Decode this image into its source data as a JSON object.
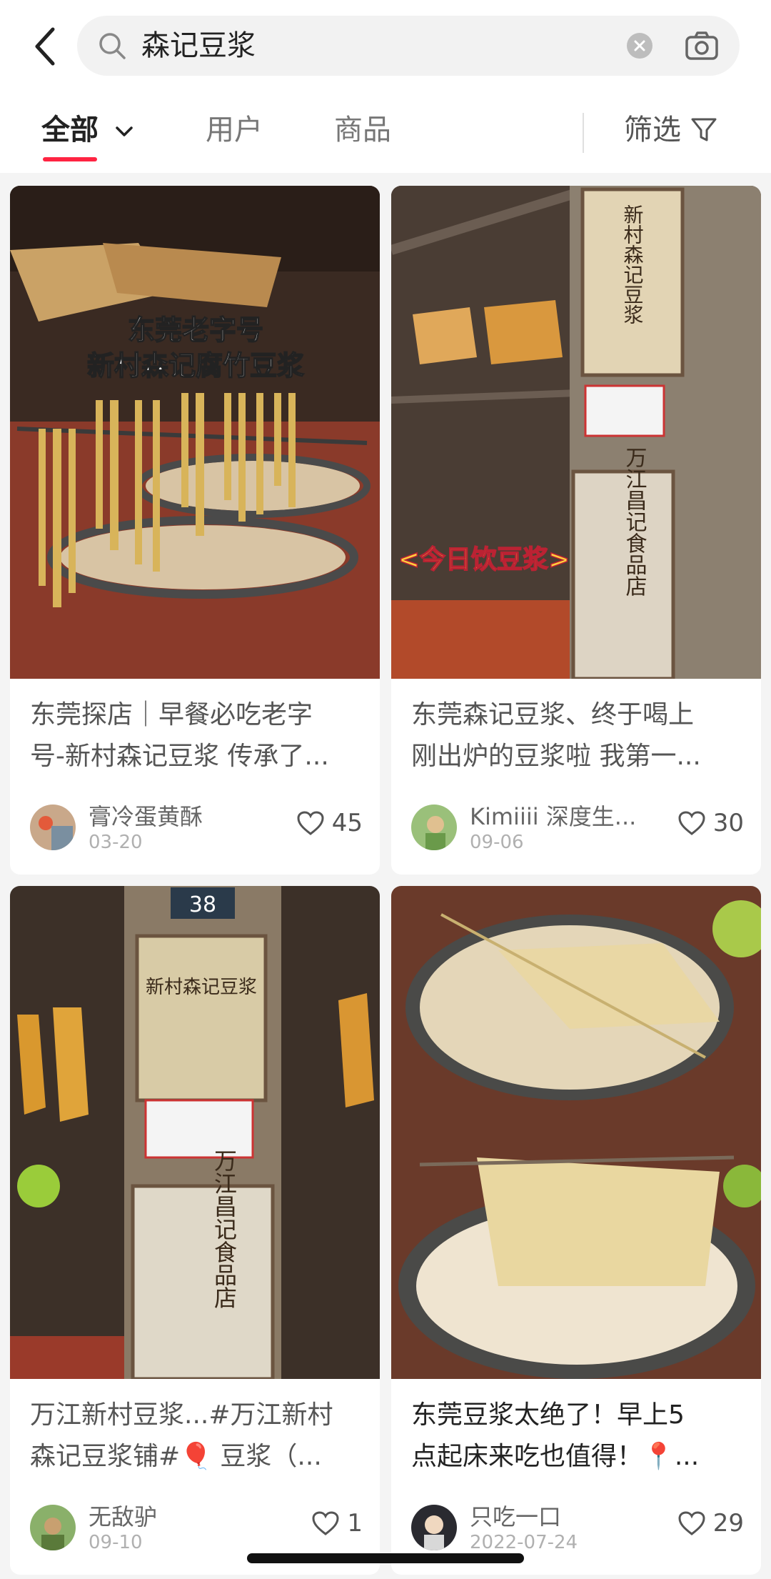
{
  "search": {
    "query": "森记豆浆"
  },
  "tabs": [
    {
      "label": "全部",
      "active": true
    },
    {
      "label": "用户",
      "active": false
    },
    {
      "label": "商品",
      "active": false
    }
  ],
  "filter_label": "筛选",
  "accent_color": "#ff2442",
  "icons": [
    "back-arrow-icon",
    "search-icon",
    "clear-icon",
    "camera-icon",
    "chevron-down-icon",
    "filter-icon",
    "heart-icon"
  ],
  "cards": [
    {
      "title_lines": [
        "东莞探店｜早餐必吃老字",
        "号-新村森记豆浆 传承了..."
      ],
      "author": "膏冷蛋黄酥",
      "date": "03-20",
      "likes": "45",
      "image_caption_lines": [
        "东莞老字号",
        "新村森记腐竹豆浆"
      ]
    },
    {
      "title_lines": [
        "东莞森记豆浆、终于喝上",
        "刚出炉的豆浆啦 我第一..."
      ],
      "author": "Kimiiii 深度生...",
      "date": "09-06",
      "likes": "30",
      "image_caption_lines": [
        "<今日饮豆浆>"
      ]
    },
    {
      "title_lines": [
        "万江新村豆浆...#万江新村",
        "森记豆浆铺#🎈 豆浆（..."
      ],
      "author": "无敌驴",
      "date": "09-10",
      "likes": "1",
      "image_caption_lines": []
    },
    {
      "title_lines": [
        "东莞豆浆太绝了！早上5",
        "点起床来吃也值得！📍..."
      ],
      "author": "只吃一口",
      "date": "2022-07-24",
      "likes": "29",
      "image_caption_lines": []
    }
  ]
}
